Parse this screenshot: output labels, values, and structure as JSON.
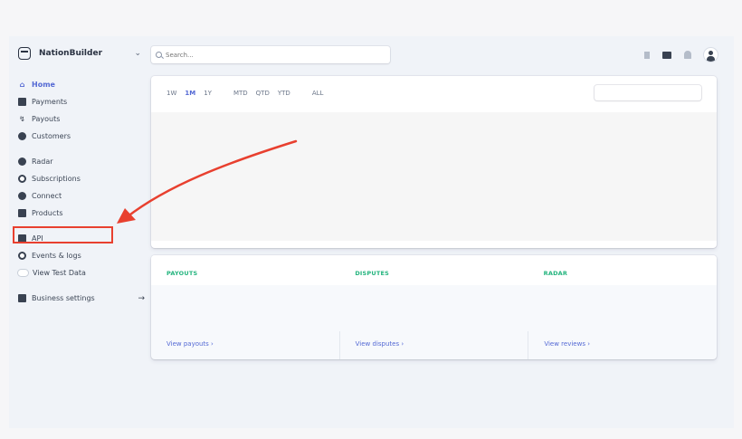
{
  "account": {
    "name": "NationBuilder"
  },
  "search": {
    "placeholder": "Search..."
  },
  "sidebar": {
    "items": [
      {
        "label": "Home",
        "icon": "home-icon"
      },
      {
        "label": "Payments",
        "icon": "payments-icon"
      },
      {
        "label": "Payouts",
        "icon": "payouts-icon"
      },
      {
        "label": "Customers",
        "icon": "customers-icon"
      },
      {
        "label": "Radar",
        "icon": "radar-icon"
      },
      {
        "label": "Subscriptions",
        "icon": "subscriptions-icon"
      },
      {
        "label": "Connect",
        "icon": "connect-icon"
      },
      {
        "label": "Products",
        "icon": "products-icon"
      },
      {
        "label": "API",
        "icon": "api-icon"
      },
      {
        "label": "Events & logs",
        "icon": "events-icon"
      },
      {
        "label": "View Test Data",
        "icon": "toggle-icon"
      },
      {
        "label": "Business settings",
        "icon": "settings-icon"
      }
    ]
  },
  "ranges": [
    "1W",
    "1M",
    "1Y",
    "MTD",
    "QTD",
    "YTD",
    "ALL"
  ],
  "selected_range": "1M",
  "stats": {
    "headers": [
      "PAYOUTS",
      "DISPUTES",
      "RADAR"
    ],
    "links": [
      "View payouts ›",
      "View disputes ›",
      "View reviews ›"
    ]
  },
  "colors": {
    "accent": "#5469d4",
    "stat_header": "#24b47e",
    "annotation": "#e8402f"
  }
}
